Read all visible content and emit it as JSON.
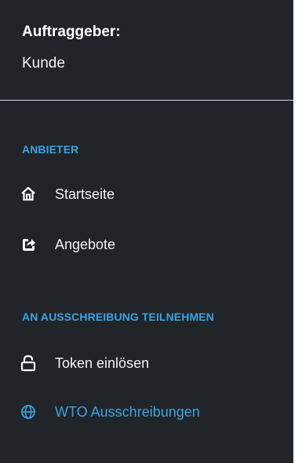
{
  "client": {
    "heading": "Auftraggeber:",
    "name": "Kunde"
  },
  "sections": [
    {
      "label": "ANBIETER",
      "items": [
        {
          "label": "Startseite",
          "icon": "home-icon"
        },
        {
          "label": "Angebote",
          "icon": "share-icon"
        }
      ]
    },
    {
      "label": "AN AUSSCHREIBUNG TEILNEHMEN",
      "items": [
        {
          "label": "Token einlösen",
          "icon": "unlock-icon"
        },
        {
          "label": "WTO Ausschreibungen",
          "icon": "globe-icon",
          "active": true
        }
      ]
    }
  ],
  "colors": {
    "background": "#212529",
    "accent": "#3aa3e3",
    "text": "#f1f3f5"
  }
}
